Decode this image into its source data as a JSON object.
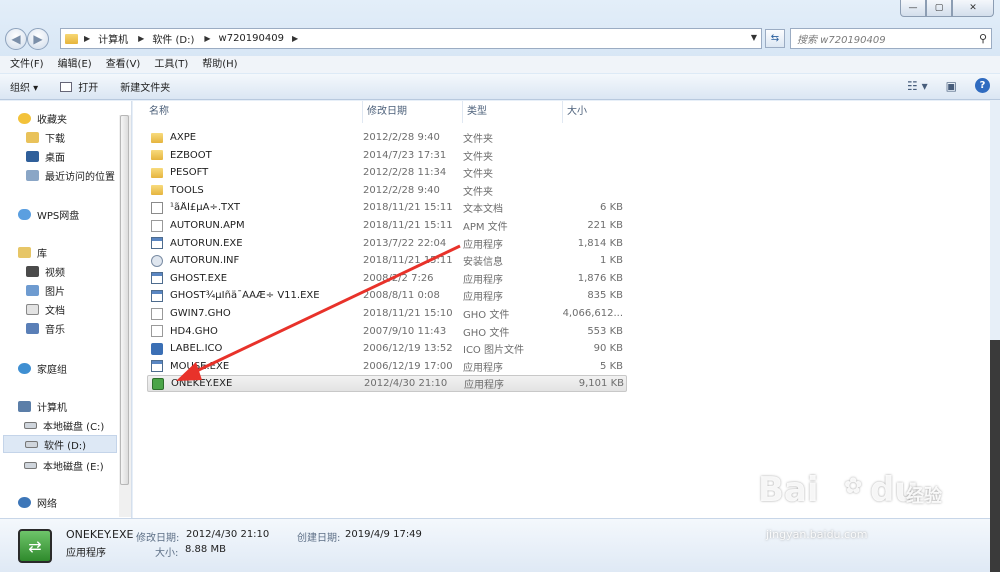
{
  "window": {
    "caption_buttons": [
      "—",
      "▢",
      "✕"
    ]
  },
  "address": {
    "crumbs": [
      "计算机",
      "软件 (D:)",
      "w720190409"
    ]
  },
  "search": {
    "placeholder": "搜索 w720190409"
  },
  "menu": [
    "文件(F)",
    "编辑(E)",
    "查看(V)",
    "工具(T)",
    "帮助(H)"
  ],
  "toolbar": {
    "organize": "组织 ▾",
    "open": "打开",
    "new_folder": "新建文件夹"
  },
  "nav": {
    "favorites": "收藏夹",
    "downloads": "下载",
    "desktop": "桌面",
    "recent": "最近访问的位置",
    "wps": "WPS网盘",
    "libraries": "库",
    "videos": "视频",
    "pictures": "图片",
    "documents": "文档",
    "music": "音乐",
    "homegroup": "家庭组",
    "computer": "计算机",
    "drive_c": "本地磁盘 (C:)",
    "drive_d": "软件 (D:)",
    "drive_e": "本地磁盘 (E:)",
    "network": "网络"
  },
  "columns": {
    "name": "名称",
    "date": "修改日期",
    "type": "类型",
    "size": "大小"
  },
  "files": [
    {
      "name": "AXPE",
      "date": "2012/2/28 9:40",
      "type": "文件夹",
      "size": "",
      "icon": "folder-icon"
    },
    {
      "name": "EZBOOT",
      "date": "2014/7/23 17:31",
      "type": "文件夹",
      "size": "",
      "icon": "folder-icon"
    },
    {
      "name": "PESOFT",
      "date": "2012/2/28 11:34",
      "type": "文件夹",
      "size": "",
      "icon": "folder-icon"
    },
    {
      "name": "TOOLS",
      "date": "2012/2/28 9:40",
      "type": "文件夹",
      "size": "",
      "icon": "folder-icon"
    },
    {
      "name": "¹ãÅÌ£µÃ÷.TXT",
      "date": "2018/11/21 15:11",
      "type": "文本文档",
      "size": "6 KB",
      "icon": "text-file-icon"
    },
    {
      "name": "AUTORUN.APM",
      "date": "2018/11/21 15:11",
      "type": "APM 文件",
      "size": "221 KB",
      "icon": "file-icon"
    },
    {
      "name": "AUTORUN.EXE",
      "date": "2013/7/22 22:04",
      "type": "应用程序",
      "size": "1,814 KB",
      "icon": "exe-icon"
    },
    {
      "name": "AUTORUN.INF",
      "date": "2018/11/21 15:11",
      "type": "安装信息",
      "size": "1 KB",
      "icon": "settings-file-icon"
    },
    {
      "name": "GHOST.EXE",
      "date": "2008/2/2 7:26",
      "type": "应用程序",
      "size": "1,876 KB",
      "icon": "exe-icon"
    },
    {
      "name": "GHOST¾µÏñä¯ÀÀÆ÷ V11.EXE",
      "date": "2008/8/11 0:08",
      "type": "应用程序",
      "size": "835 KB",
      "icon": "exe-icon"
    },
    {
      "name": "GWIN7.GHO",
      "date": "2018/11/21 15:10",
      "type": "GHO 文件",
      "size": "4,066,612...",
      "icon": "file-icon"
    },
    {
      "name": "HD4.GHO",
      "date": "2007/9/10 11:43",
      "type": "GHO 文件",
      "size": "553 KB",
      "icon": "file-icon"
    },
    {
      "name": "LABEL.ICO",
      "date": "2006/12/19 13:52",
      "type": "ICO 图片文件",
      "size": "90 KB",
      "icon": "image-file-icon"
    },
    {
      "name": "MOUSE.EXE",
      "date": "2006/12/19 17:00",
      "type": "应用程序",
      "size": "5 KB",
      "icon": "exe-icon"
    },
    {
      "name": "ONEKEY.EXE",
      "date": "2012/4/30 21:10",
      "type": "应用程序",
      "size": "9,101 KB",
      "icon": "onekey-app-icon"
    }
  ],
  "details": {
    "filename": "ONEKEY.EXE",
    "filetype": "应用程序",
    "modified_label": "修改日期:",
    "modified_value": "2012/4/30 21:10",
    "created_label": "创建日期:",
    "created_value": "2019/4/9 17:49",
    "size_label": "大小:",
    "size_value": "8.88 MB"
  },
  "watermark": {
    "brand": "Bai",
    "brand2": "du",
    "cn": "经验",
    "url": "jingyan.baidu.com"
  },
  "colors": {
    "annotation_arrow": "#e8322a",
    "selection": "#e6e6e6"
  }
}
